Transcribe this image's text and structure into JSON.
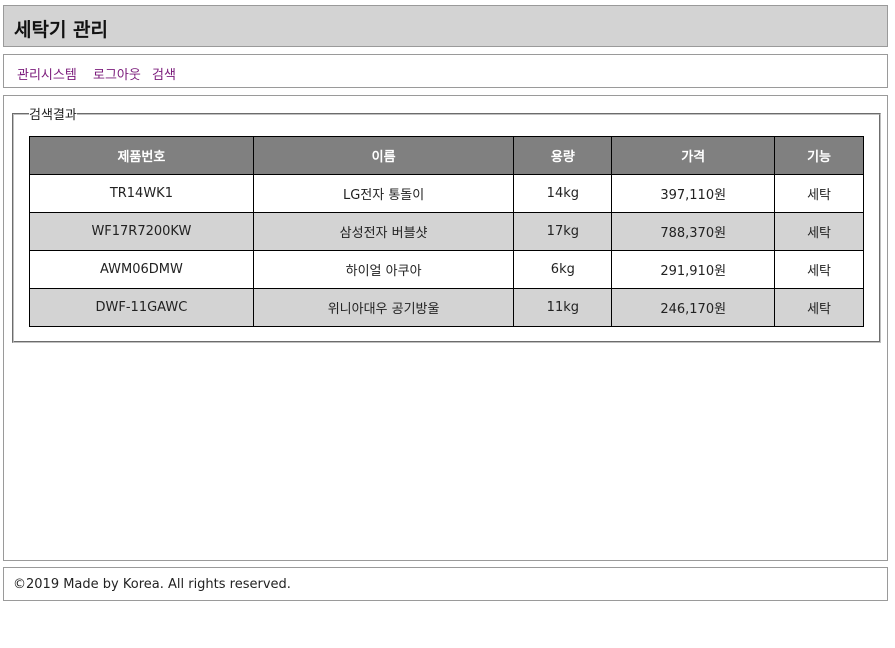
{
  "header": {
    "title": "세탁기 관리"
  },
  "nav": {
    "links": [
      "관리시스템",
      "로그아웃",
      "검색"
    ]
  },
  "results": {
    "legend": "검색결과",
    "columns": [
      "제품번호",
      "이름",
      "용량",
      "가격",
      "기능"
    ],
    "rows": [
      [
        "TR14WK1",
        "LG전자 통돌이",
        "14kg",
        "397,110원",
        "세탁"
      ],
      [
        "WF17R7200KW",
        "삼성전자 버블샷",
        "17kg",
        "788,370원",
        "세탁"
      ],
      [
        "AWM06DMW",
        "하이얼 아쿠아",
        "6kg",
        "291,910원",
        "세탁"
      ],
      [
        "DWF-11GAWC",
        "위니아대우 공기방울",
        "11kg",
        "246,170원",
        "세탁"
      ]
    ]
  },
  "footer": {
    "text": "©2019 Made by Korea. All rights reserved."
  },
  "colors": {
    "header_bg": "#d3d3d3",
    "table_header_bg": "#808080",
    "row_alt_bg": "#d3d3d3",
    "link": "#7a1a7a"
  }
}
